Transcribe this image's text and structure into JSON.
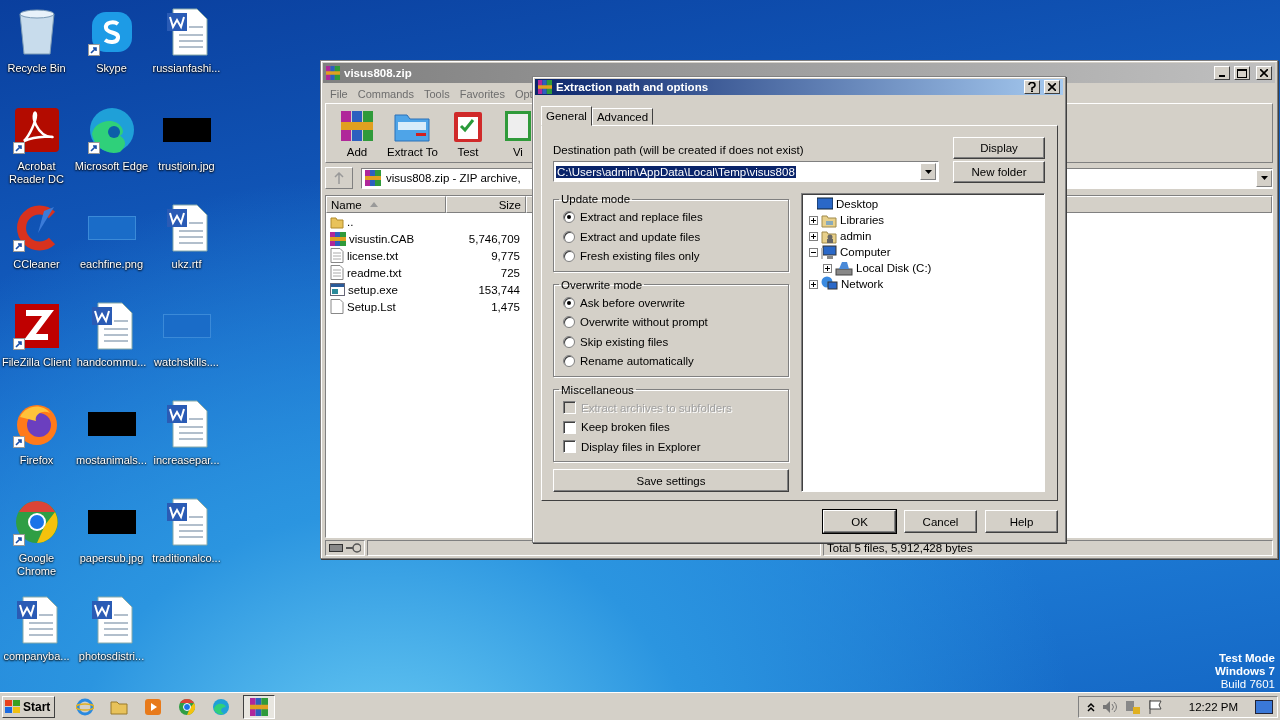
{
  "desktop_icons": [
    {
      "label": "Recycle Bin",
      "kind": "recycle-bin",
      "shortcut": false
    },
    {
      "label": "Acrobat Reader DC",
      "kind": "acrobat",
      "shortcut": true
    },
    {
      "label": "CCleaner",
      "kind": "ccleaner",
      "shortcut": true
    },
    {
      "label": "FileZilla Client",
      "kind": "filezilla",
      "shortcut": true
    },
    {
      "label": "Firefox",
      "kind": "firefox",
      "shortcut": true
    },
    {
      "label": "Google Chrome",
      "kind": "chrome",
      "shortcut": true
    },
    {
      "label": "companyba...",
      "kind": "word",
      "shortcut": false
    },
    {
      "label": "Skype",
      "kind": "skype",
      "shortcut": true
    },
    {
      "label": "Microsoft Edge",
      "kind": "edge",
      "shortcut": true
    },
    {
      "label": "eachfine.png",
      "kind": "blank-thumbnail",
      "shortcut": false
    },
    {
      "label": "handcommu...",
      "kind": "word",
      "shortcut": false
    },
    {
      "label": "mostanimals...",
      "kind": "black-thumbnail",
      "shortcut": false
    },
    {
      "label": "papersub.jpg",
      "kind": "black-thumbnail",
      "shortcut": false
    },
    {
      "label": "photosdistri...",
      "kind": "word",
      "shortcut": false
    },
    {
      "label": "russianfashi...",
      "kind": "word",
      "shortcut": false
    },
    {
      "label": "trustjoin.jpg",
      "kind": "black-thumbnail",
      "shortcut": false
    },
    {
      "label": "ukz.rtf",
      "kind": "word",
      "shortcut": false
    },
    {
      "label": "watchskills....",
      "kind": "blank-thumbnail",
      "shortcut": false
    },
    {
      "label": "increasepar...",
      "kind": "word",
      "shortcut": false
    },
    {
      "label": "traditionalco...",
      "kind": "word",
      "shortcut": false
    }
  ],
  "archive_window": {
    "title": "visus808.zip",
    "menu": [
      "File",
      "Commands",
      "Tools",
      "Favorites",
      "Opt"
    ],
    "toolbar": [
      {
        "label": "Add",
        "kind": "add"
      },
      {
        "label": "Extract To",
        "kind": "extract"
      },
      {
        "label": "Test",
        "kind": "test"
      },
      {
        "label": "Vi",
        "kind": "view"
      }
    ],
    "address": "visus808.zip - ZIP archive,",
    "columns": [
      {
        "label": "Name",
        "sorted": true
      },
      {
        "label": "Size",
        "sorted": false
      }
    ],
    "files": [
      {
        "name": "..",
        "kind": "folder"
      },
      {
        "name": "visustin.CAB",
        "kind": "archive",
        "size": "5,746,709"
      },
      {
        "name": "license.txt",
        "kind": "text",
        "size": "9,775"
      },
      {
        "name": "readme.txt",
        "kind": "text",
        "size": "725"
      },
      {
        "name": "setup.exe",
        "kind": "exe",
        "size": "153,744"
      },
      {
        "name": "Setup.Lst",
        "kind": "blank",
        "size": "1,475"
      }
    ],
    "status": "Total 5 files, 5,912,428 bytes"
  },
  "dialog": {
    "title": "Extraction path and options",
    "tabs": [
      {
        "label": "General",
        "selected": true
      },
      {
        "label": "Advanced",
        "selected": false
      }
    ],
    "destination_label": "Destination path (will be created if does not exist)",
    "destination_path": "C:\\Users\\admin\\AppData\\Local\\Temp\\visus808",
    "side_buttons": [
      "Display",
      "New folder"
    ],
    "groups": [
      {
        "title": "Update mode",
        "kind": "radio",
        "options": [
          {
            "label": "Extract and replace files",
            "selected": true
          },
          {
            "label": "Extract and update files",
            "selected": false
          },
          {
            "label": "Fresh existing files only",
            "selected": false
          }
        ]
      },
      {
        "title": "Overwrite mode",
        "kind": "radio",
        "options": [
          {
            "label": "Ask before overwrite",
            "selected": true
          },
          {
            "label": "Overwrite without prompt",
            "selected": false
          },
          {
            "label": "Skip existing files",
            "selected": false
          },
          {
            "label": "Rename automatically",
            "selected": false
          }
        ]
      },
      {
        "title": "Miscellaneous",
        "kind": "checkbox",
        "options": [
          {
            "label": "Extract archives to subfolders",
            "checked": false,
            "disabled": true
          },
          {
            "label": "Keep broken files",
            "checked": false,
            "disabled": false
          },
          {
            "label": "Display files in Explorer",
            "checked": false,
            "disabled": false
          }
        ]
      }
    ],
    "save_button": "Save settings",
    "tree": [
      {
        "label": "Desktop",
        "kind": "desktop",
        "children": [
          {
            "label": "Libraries",
            "kind": "libraries",
            "expanded": false
          },
          {
            "label": "admin",
            "kind": "user",
            "expanded": false
          },
          {
            "label": "Computer",
            "kind": "computer",
            "expanded": true,
            "children": [
              {
                "label": "Local Disk (C:)",
                "kind": "disk",
                "expanded": false
              }
            ]
          },
          {
            "label": "Network",
            "kind": "network",
            "expanded": false
          }
        ]
      }
    ],
    "buttons": [
      {
        "label": "OK",
        "default": true
      },
      {
        "label": "Cancel",
        "default": false
      },
      {
        "label": "Help",
        "default": false
      }
    ]
  },
  "system_notice": [
    "Test Mode",
    "Windows 7",
    "Build 7601"
  ],
  "taskbar": {
    "start": "Start",
    "apps": [
      {
        "kind": "ie",
        "active": false
      },
      {
        "kind": "explorer",
        "active": false
      },
      {
        "kind": "media",
        "active": false
      },
      {
        "kind": "chrome",
        "active": false
      },
      {
        "kind": "edge",
        "active": false
      },
      {
        "kind": "winrar",
        "active": true
      }
    ],
    "clock": "12:22 PM"
  }
}
